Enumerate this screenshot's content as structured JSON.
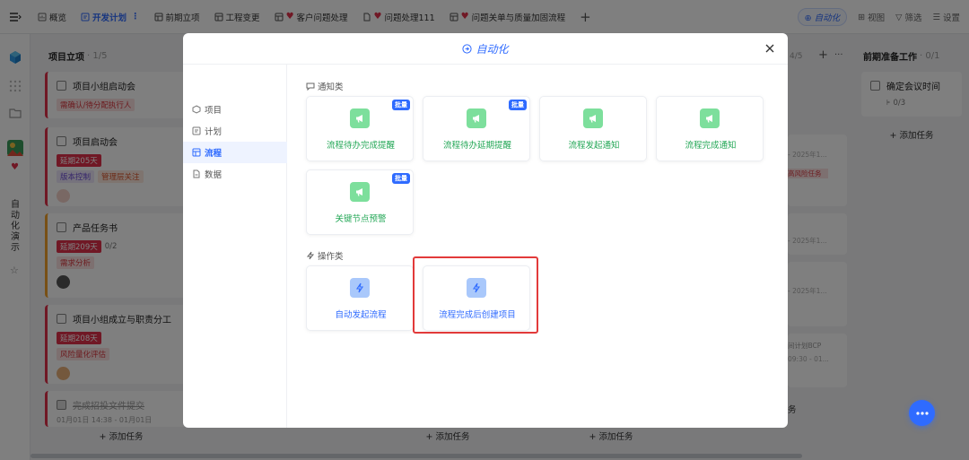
{
  "topbar": {
    "tabs": [
      {
        "label": "概览",
        "icon": "overview-icon",
        "heart": false
      },
      {
        "label": "开发计划",
        "icon": "plan-icon",
        "heart": false,
        "active": true
      },
      {
        "label": "前期立项",
        "icon": "table-icon",
        "heart": false
      },
      {
        "label": "工程变更",
        "icon": "table-icon",
        "heart": false
      },
      {
        "label": "客户问题处理",
        "icon": "table-icon",
        "heart": true
      },
      {
        "label": "问题处理111",
        "icon": "doc-icon",
        "heart": true
      },
      {
        "label": "问题关单与质量加固流程",
        "icon": "table-icon",
        "heart": true
      }
    ],
    "automation_label": "自动化",
    "view_label": "视图",
    "filter_label": "筛选",
    "settings_label": "设置"
  },
  "rail": {
    "project_name": "自动化演示"
  },
  "board": {
    "col1": {
      "title": "项目立项",
      "count": "· 1/5",
      "cards": [
        {
          "title": "项目小组启动会",
          "tags": [
            {
              "text": "需确认/待分配执行人",
              "style": "red"
            }
          ]
        },
        {
          "title": "项目启动会",
          "tags": [
            {
              "text": "延期205天",
              "style": "redfill"
            },
            {
              "text": "版本控制",
              "style": "purple"
            },
            {
              "text": "管理层关注",
              "style": "orange"
            }
          ]
        },
        {
          "title": "产品任务书",
          "tags": [
            {
              "text": "延期209天",
              "style": "redfill"
            },
            {
              "text": "需求分析",
              "style": "red"
            }
          ],
          "subtask": "0/2"
        },
        {
          "title": "项目小组成立与职责分工",
          "tags": [
            {
              "text": "延期208天",
              "style": "redfill"
            },
            {
              "text": "风险量化评估",
              "style": "red"
            }
          ]
        },
        {
          "title": "完成招投文件提交",
          "date": "01月01日 14:38 - 01月01日"
        }
      ],
      "add_label": "添加任务"
    },
    "col_mid_add_1": "添加任务",
    "col_mid_add_2": "添加任务",
    "col4": {
      "count": "4/5",
      "fragments": [
        "- 2025年1...",
        "高风险任务",
        "- 2025年1...",
        "- 2025年1...",
        "间计划BCP",
        "09:30 - 01...",
        "务"
      ]
    },
    "col5": {
      "title": "前期准备工作",
      "count": "· 0/1",
      "cards": [
        {
          "title": "确定会议时间",
          "subtask": "0/3"
        }
      ],
      "add_label": "添加任务"
    }
  },
  "modal": {
    "title": "自动化",
    "nav": [
      {
        "label": "项目",
        "icon": "project-icon"
      },
      {
        "label": "计划",
        "icon": "plan-icon"
      },
      {
        "label": "流程",
        "icon": "flow-icon",
        "active": true
      },
      {
        "label": "数据",
        "icon": "data-icon"
      }
    ],
    "notify_section": "通知类",
    "notify_cards": [
      {
        "label": "流程待办完成提醒",
        "badge": "批量"
      },
      {
        "label": "流程待办延期提醒",
        "badge": "批量"
      },
      {
        "label": "流程发起通知",
        "badge": ""
      },
      {
        "label": "流程完成通知",
        "badge": ""
      },
      {
        "label": "关键节点预警",
        "badge": "批量"
      }
    ],
    "action_section": "操作类",
    "action_cards": [
      {
        "label": "自动发起流程"
      },
      {
        "label": "流程完成后创建项目",
        "highlighted": true
      }
    ]
  },
  "colors": {
    "accent": "#2f6bff",
    "notify_green": "#23a756",
    "highlight_red": "#e23a3a"
  }
}
